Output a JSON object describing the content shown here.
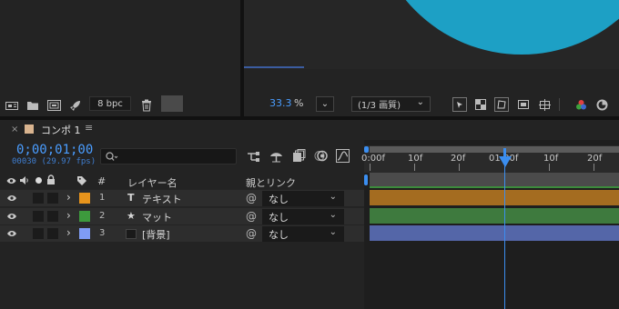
{
  "colors": {
    "accent_blue": "#4a9dff",
    "comp_circle": "#1da0c5",
    "label_orange": "#e8941c",
    "label_green": "#3d9a3d",
    "label_lavender": "#7f9cf5",
    "bar_orange": "#a46c20",
    "bar_green": "#3e7a3e",
    "bar_blue": "#5466a8"
  },
  "project_footer": {
    "bpc": "8 bpc",
    "icons": [
      "interpret-footage-icon",
      "new-folder-icon",
      "new-composition-icon",
      "render-rocket-icon",
      "trash-icon"
    ]
  },
  "viewer_footer": {
    "zoom_value": "33.3",
    "zoom_unit": "%",
    "resolution": "(1/3 画質)",
    "icons": [
      "fast-preview-icon",
      "transparency-grid-icon",
      "mask-path-icon",
      "region-of-interest-icon",
      "safe-margins-icon",
      "color-channel-icon",
      "reset-exposure-icon"
    ]
  },
  "timeline": {
    "tab_close": "×",
    "tab_label": "コンポ 1",
    "tab_menu": "≡",
    "timecode": "0;00;01;00",
    "subframe": "00030 (29.97 fps)",
    "search_placeholder": "",
    "columns": {
      "hash": "#",
      "layer_name": "レイヤー名",
      "parent": "親とリンク"
    },
    "ruler_labels": [
      "0:00f",
      "10f",
      "20f",
      "01:00f",
      "10f",
      "20f"
    ],
    "layers": [
      {
        "num": "1",
        "type_glyph": "T",
        "name": "テキスト",
        "parent": "なし"
      },
      {
        "num": "2",
        "type_glyph": "★",
        "name": "マット",
        "parent": "なし"
      },
      {
        "num": "3",
        "type_glyph": "",
        "name": "[背景]",
        "parent": "なし"
      }
    ]
  }
}
